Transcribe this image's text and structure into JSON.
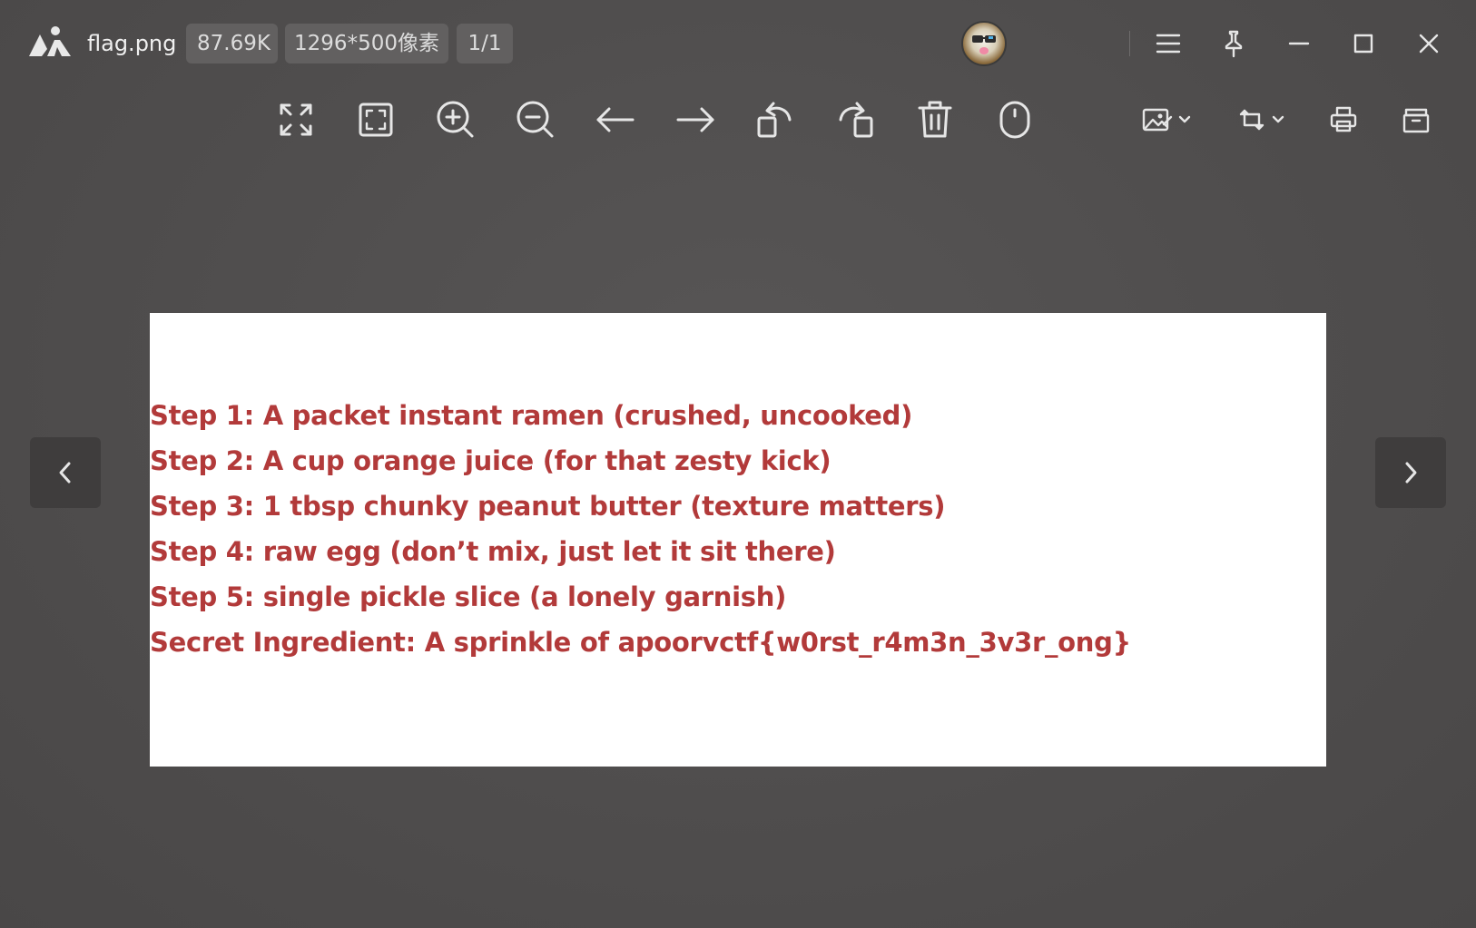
{
  "titlebar": {
    "filename": "flag.png",
    "file_size": "87.69K",
    "dimensions": "1296*500像素",
    "page_indicator": "1/1"
  },
  "toolbar": {
    "icons": [
      "fullscreen-icon",
      "fit-window-icon",
      "zoom-in-icon",
      "zoom-out-icon",
      "previous-arrow-icon",
      "next-arrow-icon",
      "rotate-left-icon",
      "rotate-right-icon",
      "delete-icon",
      "mouse-icon",
      "edit-image-icon",
      "crop-rotate-icon",
      "print-icon",
      "open-folder-icon"
    ]
  },
  "image": {
    "lines": [
      "Step 1: A packet instant ramen (crushed, uncooked)",
      "Step 2: A cup orange juice (for that zesty kick)",
      "Step 3: 1 tbsp chunky peanut butter (texture matters)",
      "Step 4: raw egg (don’t mix, just let it sit there)",
      "Step 5: single pickle slice (a lonely garnish)",
      "Secret Ingredient: A sprinkle of apoorvctf{w0rst_r4m3n_3v3r_ong}"
    ]
  },
  "colors": {
    "background": "#524f4f",
    "chip": "#626060",
    "recipe_text": "#b23a3a",
    "image_bg": "#ffffff"
  }
}
